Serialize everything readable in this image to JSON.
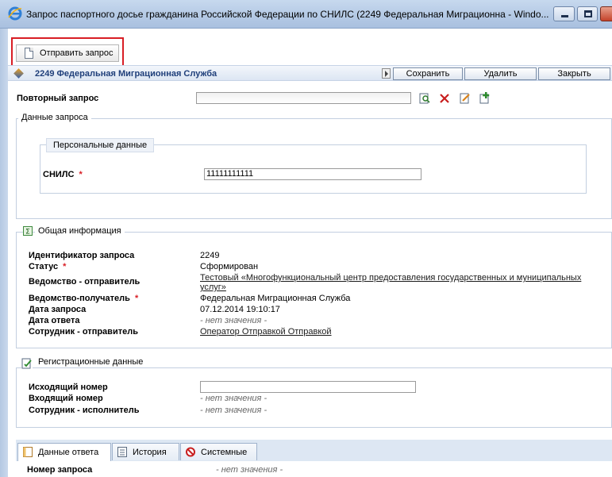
{
  "window": {
    "title": "Запрос паспортного досье гражданина Российской Федерации по СНИЛС (2249 Федеральная Миграционна - Windo..."
  },
  "toolbar": {
    "send_label": "Отправить запрос"
  },
  "header": {
    "org": "2249 Федеральная Миграционная Служба",
    "save_label": "Сохранить",
    "delete_label": "Удалить",
    "close_label": "Закрыть"
  },
  "repeat": {
    "label": "Повторный запрос",
    "value": ""
  },
  "request_data": {
    "legend": "Данные запроса",
    "personal": {
      "legend": "Персональные данные",
      "snils_label": "СНИЛС",
      "required_mark": "*",
      "snils_value": "11111111111"
    }
  },
  "general": {
    "legend": "Общая информация",
    "rows": [
      {
        "label": "Идентификатор запроса",
        "value": "2249"
      },
      {
        "label": "Статус",
        "value": "Сформирован"
      },
      {
        "label": "Ведомство - отправитель",
        "value_line1": "Тестовый «Многофункциональный центр предоставления государственных и муниципальных",
        "value_line2": "услуг»"
      },
      {
        "label": "Ведомство-получатель",
        "value": "Федеральная Миграционная Служба"
      },
      {
        "label": "Дата запроса",
        "value": "07.12.2014 19:10:17"
      },
      {
        "label": "Дата ответа",
        "value": "- нет значения -"
      },
      {
        "label": "Сотрудник - отправитель",
        "value": "Оператор Отправкой Отправкой"
      }
    ]
  },
  "registration": {
    "legend": "Регистрационные данные",
    "rows": [
      {
        "label": "Исходящий номер",
        "value": ""
      },
      {
        "label": "Входящий номер",
        "value": "- нет значения -"
      },
      {
        "label": "Сотрудник - исполнитель",
        "value": "- нет значения -"
      }
    ]
  },
  "tabs": [
    {
      "label": "Данные ответа",
      "icon": "document-icon"
    },
    {
      "label": "История",
      "icon": "history-icon"
    },
    {
      "label": "Системные",
      "icon": "forbidden-icon"
    }
  ],
  "response": {
    "label": "Номер запроса",
    "value": "- нет значения -"
  },
  "colors": {
    "highlight": "#d81e25",
    "header_text": "#1f3f7a",
    "required": "#d81e25"
  }
}
